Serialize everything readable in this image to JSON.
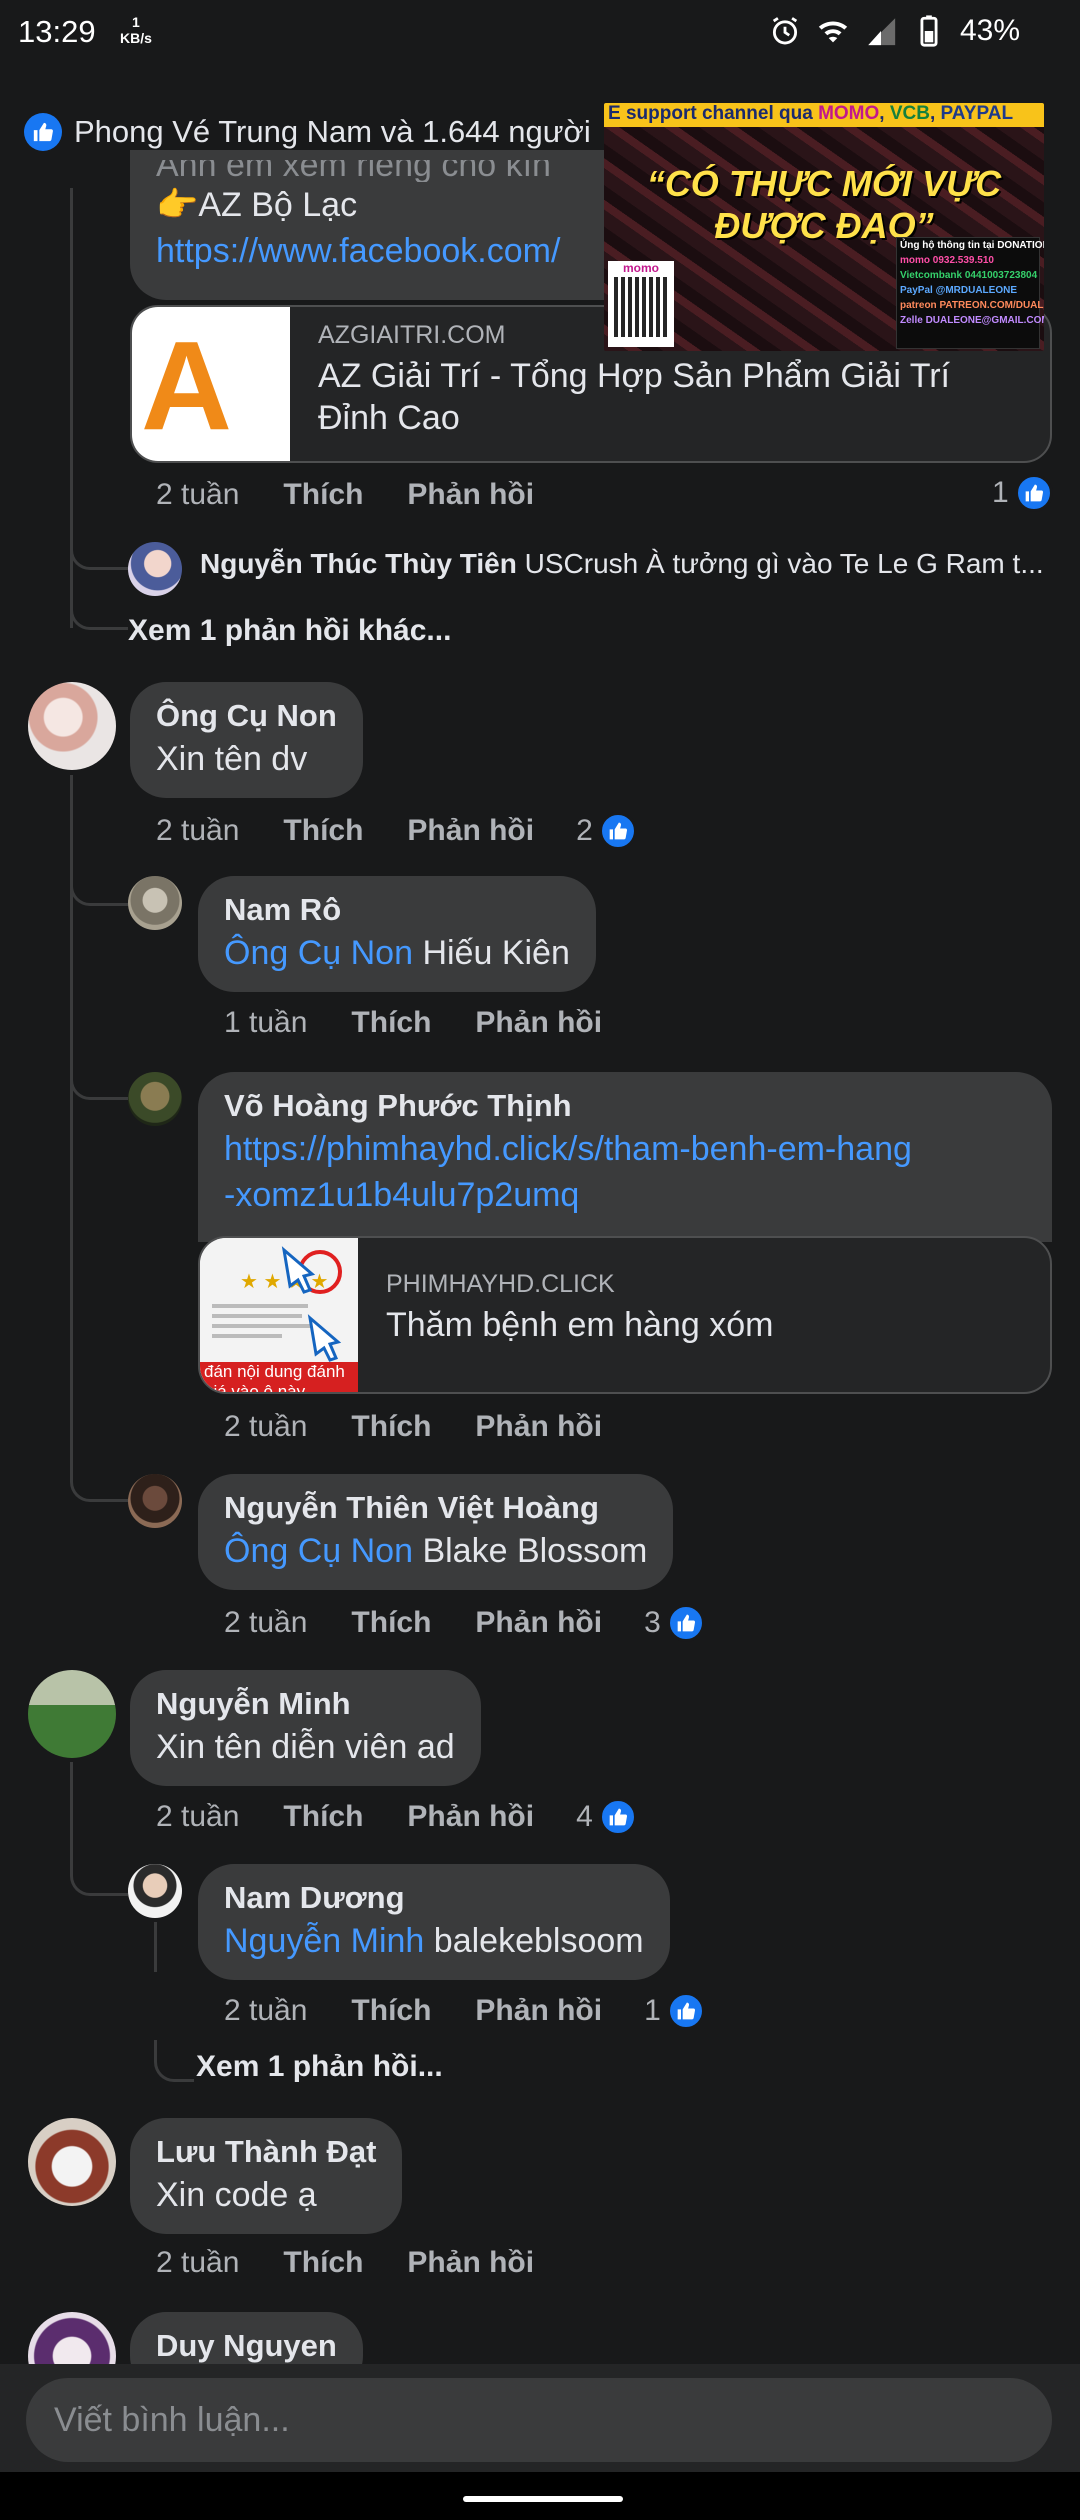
{
  "status_bar": {
    "time": "13:29",
    "net_speed_value": "1",
    "net_speed_unit": "KB/s",
    "battery": "43%"
  },
  "reactions": {
    "text": "Phong Vé Trung Nam và 1.644 người"
  },
  "video_overlay": {
    "banner_prefix": "E support channel qua ",
    "banner_momo": "MOMO",
    "banner_vcb": "VCB",
    "banner_paypal": "PAYPAL",
    "title": "“CÓ THỰC MỚI VỰC ĐƯỢC ĐẠO”",
    "qr_label": "momo",
    "donate_lines": [
      "Ủng hộ thông tin tại DONATION",
      "momo 0932.539.510",
      "Vietcombank 0441003723804",
      "PayPal @MRDUALEONE",
      "patreon PATREON.COM/DUALEONE",
      "Zelle DUALEONE@GMAIL.COM"
    ]
  },
  "top_comment": {
    "partial_text": "Anh em xem riêng cho kín",
    "line": "👉AZ Bộ Lạc",
    "link": "https://www.facebook.com/",
    "preview": {
      "thumb_text": "IA",
      "domain": "AZGIAITRI.COM",
      "title_line1": "AZ Giải Trí - Tổng Hợp Sản Phẩm Giải Trí",
      "title_line2": "Đỉnh Cao"
    },
    "time": "2 tuần",
    "like": "Thích",
    "reply": "Phản hồi",
    "like_count": "1"
  },
  "inline_reply": {
    "name": "Nguyễn Thúc Thùy Tiên",
    "text": "USCrush À tưởng gì vào Te Le G Ram t..."
  },
  "more_replies_1": "Xem 1 phản hồi khác...",
  "comments": [
    {
      "name": "Ông Cụ Non",
      "text": "Xin tên dv",
      "time": "2 tuần",
      "like": "Thích",
      "reply": "Phản hồi",
      "like_count": "2"
    },
    {
      "name": "Nam Rô",
      "mention": "Ông Cụ Non",
      "text": "Hiếu Kiên",
      "time": "1 tuần",
      "like": "Thích",
      "reply": "Phản hồi"
    },
    {
      "name": "Võ Hoàng Phước Thịnh",
      "link_line1": "https://phimhayhd.click/s/tham-benh-em-hang",
      "link_line2": "-xomz1u1b4ulu7p2umq",
      "preview": {
        "domain": "PHIMHAYHD.CLICK",
        "title": "Thăm bệnh em hàng xóm",
        "thumb_caption": "đán nội dung đánh giá vào ô này"
      },
      "time": "2 tuần",
      "like": "Thích",
      "reply": "Phản hồi"
    },
    {
      "name": "Nguyễn Thiên Việt Hoàng",
      "mention": "Ông Cụ Non",
      "text": "Blake Blossom",
      "time": "2 tuần",
      "like": "Thích",
      "reply": "Phản hồi",
      "like_count": "3"
    },
    {
      "name": "Nguyễn Minh",
      "text": "Xin tên diễn viên ad",
      "time": "2 tuần",
      "like": "Thích",
      "reply": "Phản hồi",
      "like_count": "4"
    },
    {
      "name": "Nam Dương",
      "mention": "Nguyễn Minh",
      "text": "balekeblsoom",
      "time": "2 tuần",
      "like": "Thích",
      "reply": "Phản hồi",
      "like_count": "1"
    },
    {
      "name": "Lưu Thành Đạt",
      "text": "Xin code ạ",
      "time": "2 tuần",
      "like": "Thích",
      "reply": "Phản hồi"
    },
    {
      "name": "Duy Nguyen"
    }
  ],
  "more_replies_2": "Xem 1 phản hồi...",
  "composer": {
    "placeholder": "Viết bình luận..."
  },
  "colors": {
    "background": "#18191a",
    "bubble": "#3a3b3c",
    "link": "#4599ff",
    "like_blue": "#1877f2",
    "muted": "#b0b3b8"
  }
}
